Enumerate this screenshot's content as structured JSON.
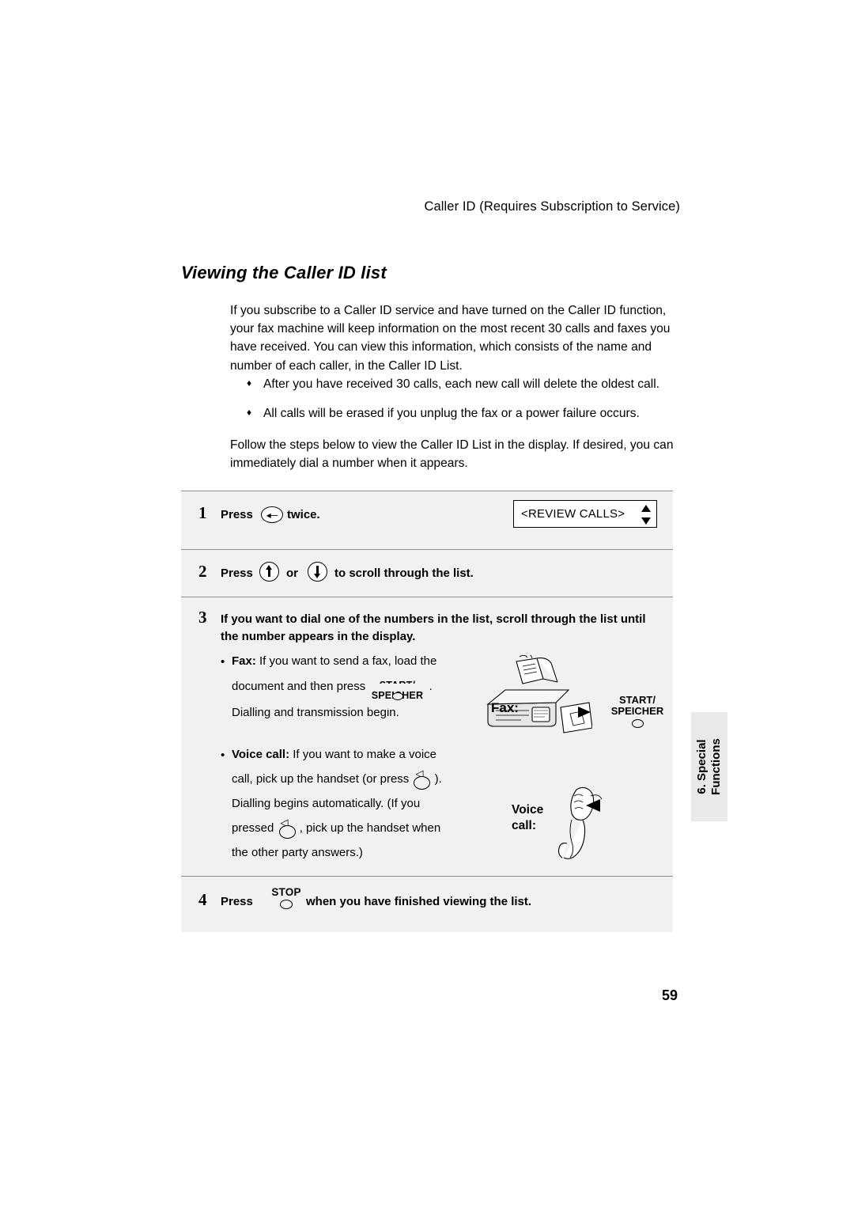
{
  "header": {
    "running_title": "Caller ID (Requires Subscription to Service)"
  },
  "section": {
    "title": "Viewing the Caller ID list",
    "intro": "If you subscribe to a Caller ID service and have turned on the Caller ID function, your fax machine will keep information on the most recent 30 calls and faxes you have received. You can view this information, which consists of the name and number of each caller, in the Caller ID List.",
    "bullets": [
      "After you have received 30 calls, each new call will delete the oldest call.",
      "All calls will be erased if you unplug the fax or a power failure occurs."
    ],
    "bullet_marker": "♦",
    "follow": "Follow the steps below to view the Caller ID List in the display. If desired, you can immediately dial a number when it appears."
  },
  "steps": {
    "step1": {
      "number": "1",
      "press_label": "Press",
      "after_key": "twice.",
      "key_icon": "caller-id-key-icon",
      "display_text": "<REVIEW CALLS>"
    },
    "step2": {
      "number": "2",
      "press_label": "Press",
      "or_label": "or",
      "tail_label": "to  scroll through the list.",
      "up_icon": "arrow-up-key-icon",
      "down_icon": "arrow-down-key-icon"
    },
    "step3": {
      "number": "3",
      "text": "If you want to dial one of the numbers in the list, scroll through the list until the number appears in the display.",
      "fax_item": {
        "bold_lead": "Fax:",
        "line1": " If you want to send a fax, load the",
        "line2_pre": "document and then press",
        "line2_post": ".",
        "line3": "Dialling and transmission begin.",
        "key_line1": "START/",
        "key_line2": "SPEICHER"
      },
      "voice_item": {
        "bold_lead": "Voice call:",
        "line1": " If you want to make a voice",
        "line2_pre": "call, pick up the handset (or press",
        "line2_post": ").",
        "line3": "Dialling begins automatically. (If you",
        "line4_pre": "pressed",
        "line4_post": ", pick up the handset when",
        "line5": "the other party answers.)"
      },
      "fax_callout": "Fax:",
      "voice_callout_line1": "Voice",
      "voice_callout_line2": "call:",
      "start_graphic_line1": "START/",
      "start_graphic_line2": "SPEICHER"
    },
    "step4": {
      "number": "4",
      "press_label": "Press",
      "key_label": "STOP",
      "tail_label": "when you have finished viewing the list."
    }
  },
  "side_tab": {
    "line1": "6. Special",
    "line2": "Functions",
    "combined": "6. Special Functions"
  },
  "footer": {
    "page_number": "59"
  },
  "colors": {
    "panel_bg": "#f1f1f1",
    "tab_bg": "#e9e9e9",
    "rule": "#8f8f8f",
    "text": "#000000"
  }
}
